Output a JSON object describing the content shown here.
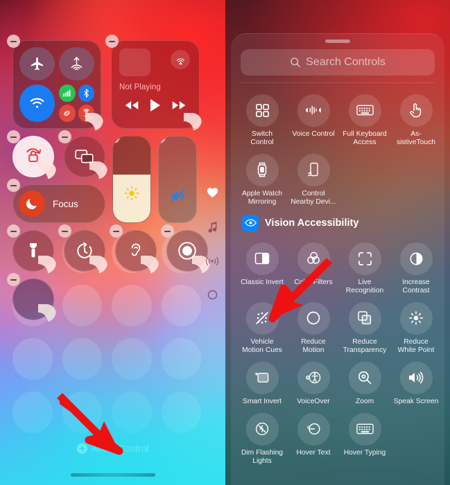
{
  "left_panel": {
    "name": "Control Center Edit Mode",
    "media": {
      "status_label": "Not Playing",
      "airplay_icon": "airplay-audio-icon",
      "rewind_icon": "rewind-icon",
      "play_icon": "play-icon",
      "fastforward_icon": "fast-forward-icon"
    },
    "connectivity": {
      "airplane_icon": "airplane-mode-icon",
      "airdrop_icon": "airdrop-icon",
      "wifi_icon": "wifi-icon",
      "cellular_icon": "cellular-data-icon",
      "bluetooth_icon": "bluetooth-icon",
      "airdrop_small_icon": "airdrop-small-icon",
      "hotspot_icon": "personal-hotspot-icon"
    },
    "controls": {
      "rotation_lock_icon": "rotation-lock-icon",
      "screen_mirroring_icon": "screen-mirroring-icon",
      "focus_label": "Focus",
      "focus_icon": "moon-icon",
      "brightness_icon": "brightness-sun-icon",
      "volume_icon": "volume-mute-icon",
      "flashlight_icon": "flashlight-icon",
      "timer_icon": "timer-icon",
      "hearing_icon": "hearing-ear-icon",
      "screen_record_icon": "screen-record-icon"
    },
    "page_indicators": [
      {
        "icon": "heart-icon",
        "active": true
      },
      {
        "icon": "music-note-icon",
        "active": false
      },
      {
        "icon": "connectivity-broadcast-icon",
        "active": false
      },
      {
        "icon": "circle-icon",
        "active": false
      }
    ],
    "add_control": {
      "label": "Add a Control",
      "icon": "plus-circle-icon"
    },
    "annotation_arrow": "red-arrow-pointing-to-add-a-control"
  },
  "right_panel": {
    "name": "Controls Gallery",
    "grabber": "sheet-grabber",
    "search": {
      "placeholder": "Search Controls",
      "icon": "search-icon"
    },
    "top_controls": [
      {
        "label": "Switch\nControl",
        "icon": "switch-control-icon"
      },
      {
        "label": "Voice Control",
        "icon": "voice-control-icon"
      },
      {
        "label": "Full Keyboard\nAccess",
        "icon": "keyboard-icon"
      },
      {
        "label": "As-\nsistiveTouch",
        "icon": "assistive-touch-icon"
      },
      {
        "label": "Apple Watch\nMirroring",
        "icon": "apple-watch-icon"
      },
      {
        "label": "Control\nNearby Devi...",
        "icon": "control-nearby-devices-icon"
      }
    ],
    "section": {
      "title": "Vision Accessibility",
      "icon": "eye-icon",
      "icon_color": "#0a84ff"
    },
    "vision_controls": [
      {
        "label": "Classic Invert",
        "icon": "classic-invert-icon"
      },
      {
        "label": "Color Filters",
        "icon": "color-filters-icon"
      },
      {
        "label": "Live\nRecognition",
        "icon": "live-recognition-icon"
      },
      {
        "label": "Increase\nContrast",
        "icon": "increase-contrast-icon"
      },
      {
        "label": "Vehicle\nMotion Cues",
        "icon": "vehicle-motion-cues-icon"
      },
      {
        "label": "Reduce\nMotion",
        "icon": "reduce-motion-icon"
      },
      {
        "label": "Reduce\nTransparency",
        "icon": "reduce-transparency-icon"
      },
      {
        "label": "Reduce\nWhite Point",
        "icon": "reduce-white-point-icon"
      },
      {
        "label": "Smart Invert",
        "icon": "smart-invert-icon"
      },
      {
        "label": "VoiceOver",
        "icon": "voiceover-icon"
      },
      {
        "label": "Zoom",
        "icon": "zoom-magnifier-icon"
      },
      {
        "label": "Speak Screen",
        "icon": "speak-screen-icon"
      },
      {
        "label": "Dim Flashing\nLights",
        "icon": "dim-flashing-lights-icon"
      },
      {
        "label": "Hover Text",
        "icon": "hover-text-icon"
      },
      {
        "label": "Hover Typing",
        "icon": "hover-typing-icon"
      }
    ],
    "annotation_arrow": "red-arrow-pointing-to-vehicle-motion-cues"
  }
}
